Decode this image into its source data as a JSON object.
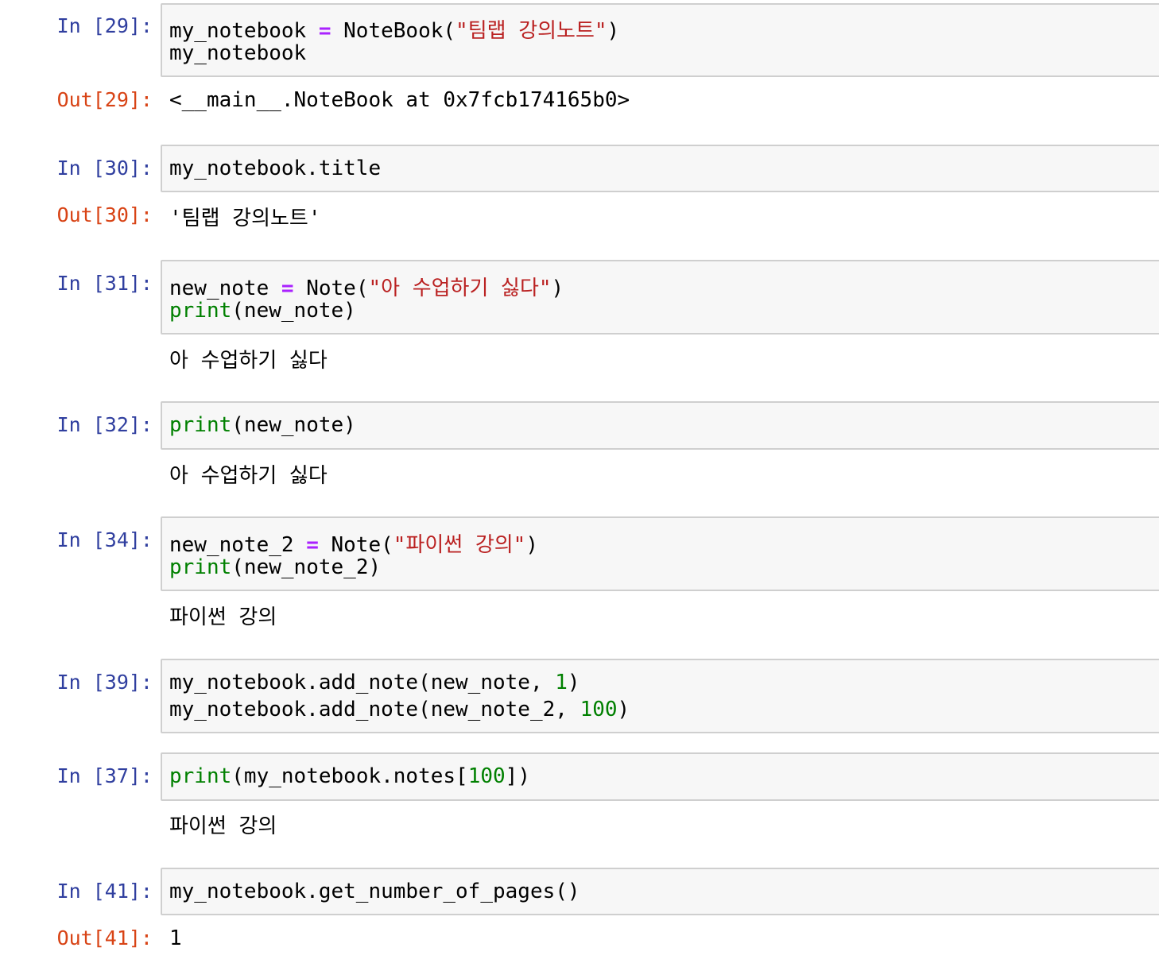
{
  "cells": [
    {
      "in_prompt": "In [29]:",
      "code": [
        [
          {
            "t": "my_notebook ",
            "c": "plain"
          },
          {
            "t": "=",
            "c": "op"
          },
          {
            "t": " NoteBook(",
            "c": "plain"
          },
          {
            "t": "\"팀랩 강의노트\"",
            "c": "str"
          },
          {
            "t": ")",
            "c": "plain"
          }
        ],
        [
          {
            "t": "my_notebook",
            "c": "plain"
          }
        ]
      ],
      "out_prompt": "Out[29]:",
      "output": "<__main__.NoteBook at 0x7fcb174165b0>"
    },
    {
      "in_prompt": "In [30]:",
      "code": [
        [
          {
            "t": "my_notebook.title",
            "c": "plain"
          }
        ]
      ],
      "out_prompt": "Out[30]:",
      "output": "'팀랩 강의노트'"
    },
    {
      "in_prompt": "In [31]:",
      "code": [
        [
          {
            "t": "new_note ",
            "c": "plain"
          },
          {
            "t": "=",
            "c": "op"
          },
          {
            "t": " Note(",
            "c": "plain"
          },
          {
            "t": "\"아 수업하기 싫다\"",
            "c": "str"
          },
          {
            "t": ")",
            "c": "plain"
          }
        ],
        [
          {
            "t": "print",
            "c": "kw"
          },
          {
            "t": "(new_note)",
            "c": "plain"
          }
        ]
      ],
      "output": "아 수업하기 싫다"
    },
    {
      "in_prompt": "In [32]:",
      "code": [
        [
          {
            "t": "print",
            "c": "kw"
          },
          {
            "t": "(new_note)",
            "c": "plain"
          }
        ]
      ],
      "output": "아 수업하기 싫다"
    },
    {
      "in_prompt": "In [34]:",
      "code": [
        [
          {
            "t": "new_note_2 ",
            "c": "plain"
          },
          {
            "t": "=",
            "c": "op"
          },
          {
            "t": " Note(",
            "c": "plain"
          },
          {
            "t": "\"파이썬 강의\"",
            "c": "str"
          },
          {
            "t": ")",
            "c": "plain"
          }
        ],
        [
          {
            "t": "print",
            "c": "kw"
          },
          {
            "t": "(new_note_2)",
            "c": "plain"
          }
        ]
      ],
      "output": "파이썬 강의"
    },
    {
      "in_prompt": "In [39]:",
      "code": [
        [
          {
            "t": "my_notebook.add_note(new_note, ",
            "c": "plain"
          },
          {
            "t": "1",
            "c": "num"
          },
          {
            "t": ")",
            "c": "plain"
          }
        ],
        [
          {
            "t": "my_notebook.add_note(new_note_2, ",
            "c": "plain"
          },
          {
            "t": "100",
            "c": "num"
          },
          {
            "t": ")",
            "c": "plain"
          }
        ]
      ]
    },
    {
      "in_prompt": "In [37]:",
      "code": [
        [
          {
            "t": "print",
            "c": "kw"
          },
          {
            "t": "(my_notebook.notes[",
            "c": "plain"
          },
          {
            "t": "100",
            "c": "num"
          },
          {
            "t": "])",
            "c": "plain"
          }
        ]
      ],
      "output": "파이썬 강의"
    },
    {
      "in_prompt": "In [41]:",
      "code": [
        [
          {
            "t": "my_notebook.get_number_of_pages()",
            "c": "plain"
          }
        ]
      ],
      "out_prompt": "Out[41]:",
      "output": "1"
    }
  ]
}
